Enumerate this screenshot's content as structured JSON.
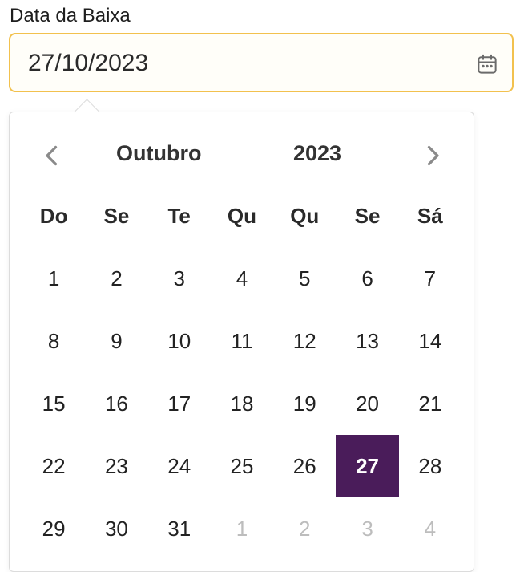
{
  "field": {
    "label": "Data da Baixa",
    "value": "27/10/2023",
    "icon": "calendar-icon"
  },
  "calendar": {
    "month": "Outubro",
    "year": "2023",
    "prev_icon": "chevron-left-icon",
    "next_icon": "chevron-right-icon",
    "weekdays": [
      "Do",
      "Se",
      "Te",
      "Qu",
      "Qu",
      "Se",
      "Sá"
    ],
    "selected_day": "27",
    "selected_color": "#4a1c5a",
    "weeks": [
      [
        {
          "d": "1"
        },
        {
          "d": "2"
        },
        {
          "d": "3"
        },
        {
          "d": "4"
        },
        {
          "d": "5"
        },
        {
          "d": "6"
        },
        {
          "d": "7"
        }
      ],
      [
        {
          "d": "8"
        },
        {
          "d": "9"
        },
        {
          "d": "10"
        },
        {
          "d": "11"
        },
        {
          "d": "12"
        },
        {
          "d": "13"
        },
        {
          "d": "14"
        }
      ],
      [
        {
          "d": "15"
        },
        {
          "d": "16"
        },
        {
          "d": "17"
        },
        {
          "d": "18"
        },
        {
          "d": "19"
        },
        {
          "d": "20"
        },
        {
          "d": "21"
        }
      ],
      [
        {
          "d": "22"
        },
        {
          "d": "23"
        },
        {
          "d": "24"
        },
        {
          "d": "25"
        },
        {
          "d": "26"
        },
        {
          "d": "27",
          "selected": true
        },
        {
          "d": "28"
        }
      ],
      [
        {
          "d": "29"
        },
        {
          "d": "30"
        },
        {
          "d": "31"
        },
        {
          "d": "1",
          "muted": true
        },
        {
          "d": "2",
          "muted": true
        },
        {
          "d": "3",
          "muted": true
        },
        {
          "d": "4",
          "muted": true
        }
      ]
    ]
  }
}
